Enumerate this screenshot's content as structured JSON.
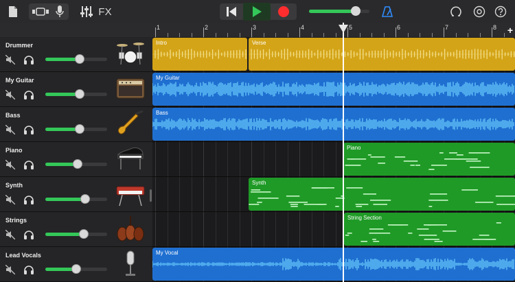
{
  "toolbar": {
    "fx_label": "FX",
    "master_volume": 0.75,
    "icons": [
      "document-icon",
      "view-toggle-icon",
      "microphone-icon",
      "mixer-icon",
      "go-to-start-icon",
      "play-icon",
      "record-icon",
      "metronome-icon",
      "loop-icon",
      "settings-icon",
      "help-icon",
      "add-icon"
    ]
  },
  "ruler": {
    "bars": [
      "1",
      "2",
      "3",
      "4",
      "5",
      "6",
      "7",
      "8"
    ]
  },
  "colors": {
    "drummer": "#d4a418",
    "audio": "#1f6fd1",
    "midi": "#1f9a26",
    "volume": "#34c759",
    "record": "#ff2d2d",
    "play": "#34c759",
    "accent": "#2f8dff"
  },
  "tracks": [
    {
      "name": "Drummer",
      "volume": 0.55,
      "instrument": "drum-kit-icon"
    },
    {
      "name": "My Guitar",
      "volume": 0.55,
      "instrument": "guitar-amp-icon"
    },
    {
      "name": "Bass",
      "volume": 0.55,
      "instrument": "bass-guitar-icon"
    },
    {
      "name": "Piano",
      "volume": 0.52,
      "instrument": "grand-piano-icon"
    },
    {
      "name": "Synth",
      "volume": 0.64,
      "instrument": "synth-keyboard-icon"
    },
    {
      "name": "Strings",
      "volume": 0.62,
      "instrument": "violin-section-icon"
    },
    {
      "name": "Lead Vocals",
      "volume": 0.5,
      "instrument": "studio-microphone-icon"
    }
  ],
  "regions": {
    "intro": "Intro",
    "verse": "Verse",
    "my_guitar": "My Guitar",
    "bass": "Bass",
    "piano": "Piano",
    "synth": "Synth",
    "strings": "String Section",
    "vocal": "My Vocal"
  }
}
